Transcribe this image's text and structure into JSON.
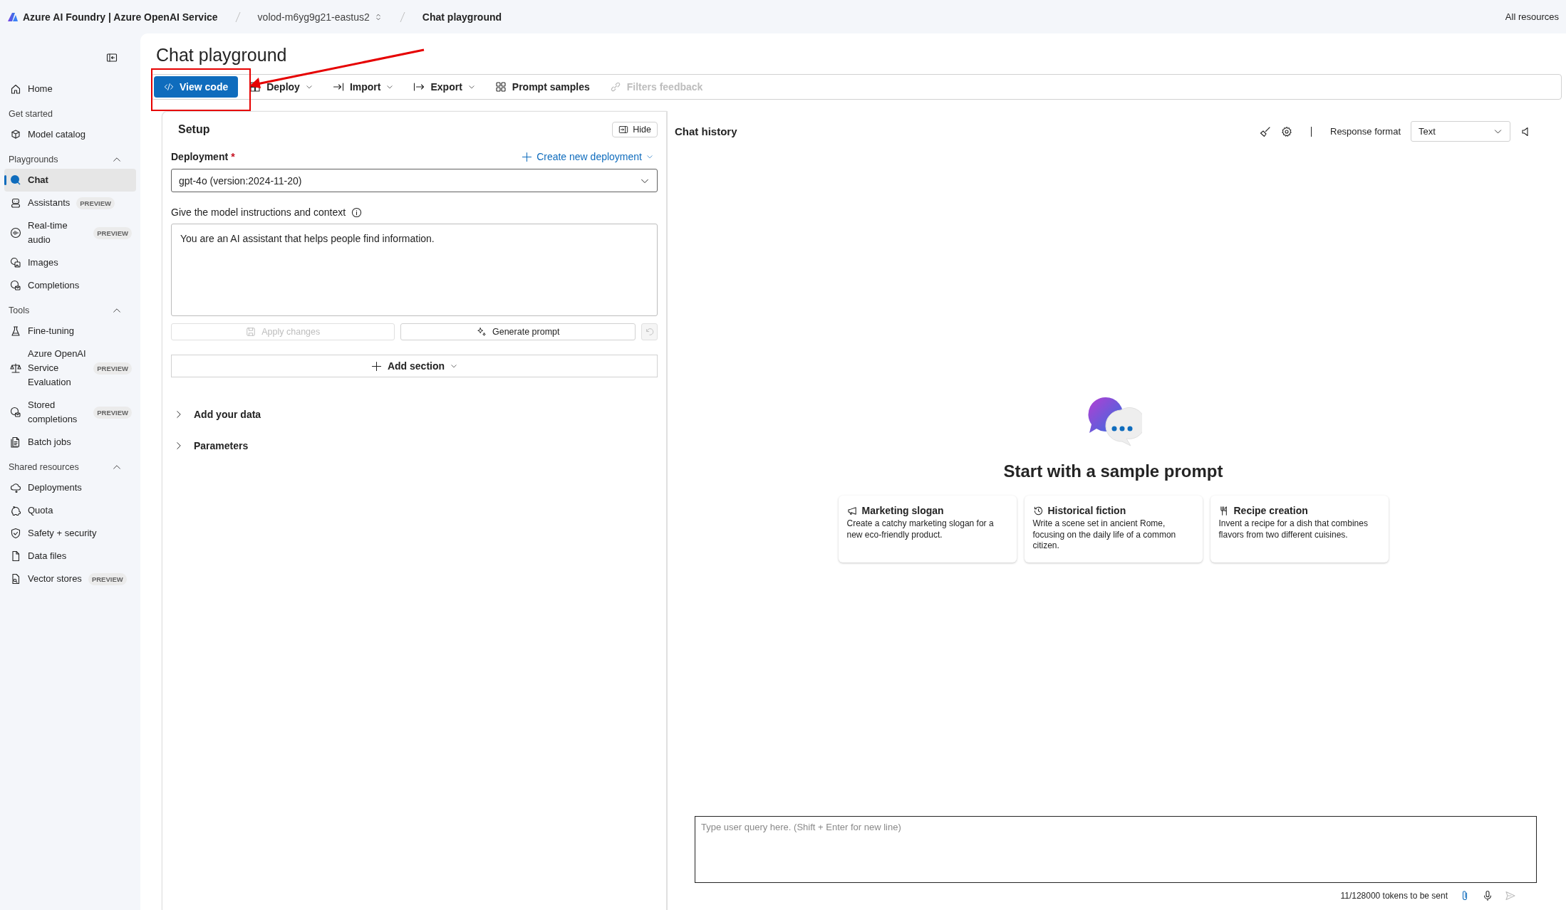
{
  "top_bar": {
    "breadcrumbs": [
      {
        "label": "Azure AI Foundry | Azure OpenAI Service"
      },
      {
        "label": "volod-m6yg9g21-eastus2"
      },
      {
        "label": "Chat playground"
      }
    ],
    "right_link": "All resources"
  },
  "sidebar": {
    "items": [
      {
        "kind": "link",
        "label": "Home",
        "selected": false
      },
      {
        "kind": "heading",
        "label": "Get started"
      },
      {
        "kind": "link",
        "label": "Model catalog",
        "selected": false
      },
      {
        "kind": "group",
        "label": "Playgrounds",
        "expanded": true
      },
      {
        "kind": "link",
        "label": "Chat",
        "selected": true
      },
      {
        "kind": "link",
        "label": "Assistants",
        "selected": false,
        "badge": "PREVIEW"
      },
      {
        "kind": "link",
        "label": "Real-time audio",
        "selected": false,
        "badge": "PREVIEW"
      },
      {
        "kind": "link",
        "label": "Images",
        "selected": false
      },
      {
        "kind": "link",
        "label": "Completions",
        "selected": false
      },
      {
        "kind": "group",
        "label": "Tools",
        "expanded": true
      },
      {
        "kind": "link",
        "label": "Fine-tuning",
        "selected": false
      },
      {
        "kind": "link",
        "label": "Azure OpenAI Service Evaluation",
        "selected": false,
        "badge": "PREVIEW"
      },
      {
        "kind": "link",
        "label": "Stored completions",
        "selected": false,
        "badge": "PREVIEW"
      },
      {
        "kind": "link",
        "label": "Batch jobs",
        "selected": false
      },
      {
        "kind": "group",
        "label": "Shared resources",
        "expanded": true
      },
      {
        "kind": "link",
        "label": "Deployments",
        "selected": false
      },
      {
        "kind": "link",
        "label": "Quota",
        "selected": false
      },
      {
        "kind": "link",
        "label": "Safety + security",
        "selected": false
      },
      {
        "kind": "link",
        "label": "Data files",
        "selected": false
      },
      {
        "kind": "link",
        "label": "Vector stores",
        "selected": false,
        "badge": "PREVIEW"
      }
    ]
  },
  "page": {
    "title": "Chat playground"
  },
  "toolbar": [
    {
      "label": "View code",
      "kind": "primary",
      "dropdown": false,
      "disabled": false
    },
    {
      "label": "Deploy",
      "kind": "plain",
      "dropdown": true,
      "disabled": false
    },
    {
      "label": "Import",
      "kind": "plain",
      "dropdown": true,
      "disabled": false
    },
    {
      "label": "Export",
      "kind": "plain",
      "dropdown": true,
      "disabled": false
    },
    {
      "label": "Prompt samples",
      "kind": "plain",
      "dropdown": false,
      "disabled": false
    },
    {
      "label": "Filters feedback",
      "kind": "plain",
      "dropdown": false,
      "disabled": true
    }
  ],
  "setup": {
    "title": "Setup",
    "hide_button": "Hide",
    "deployment_label": "Deployment",
    "required_mark": "*",
    "create_link": "Create new deployment",
    "deployment_value": "gpt-4o (version:2024-11-20)",
    "instructions_label": "Give the model instructions and context",
    "instructions_value": "You are an AI assistant that helps people find information.",
    "actions": [
      {
        "label": "Apply changes",
        "disabled": true
      },
      {
        "label": "Generate prompt",
        "disabled": false
      }
    ],
    "add_section": "Add section",
    "sections": [
      {
        "label": "Add your data",
        "expanded": false
      },
      {
        "label": "Parameters",
        "expanded": false
      }
    ]
  },
  "chat": {
    "title": "Chat history",
    "response_format_label": "Response format",
    "response_format_value": "Text",
    "heading": "Start with a sample prompt",
    "samples": [
      {
        "title": "Marketing slogan",
        "text": "Create a catchy marketing slogan for a new eco-friendly product."
      },
      {
        "title": "Historical fiction",
        "text": "Write a scene set in ancient Rome, focusing on the daily life of a common citizen."
      },
      {
        "title": "Recipe creation",
        "text": "Invent a recipe for a dish that combines flavors from two different cuisines."
      }
    ],
    "input_placeholder": "Type user query here. (Shift + Enter for new line)",
    "token_count": "11/128000 tokens to be sent",
    "send_disabled": true
  }
}
